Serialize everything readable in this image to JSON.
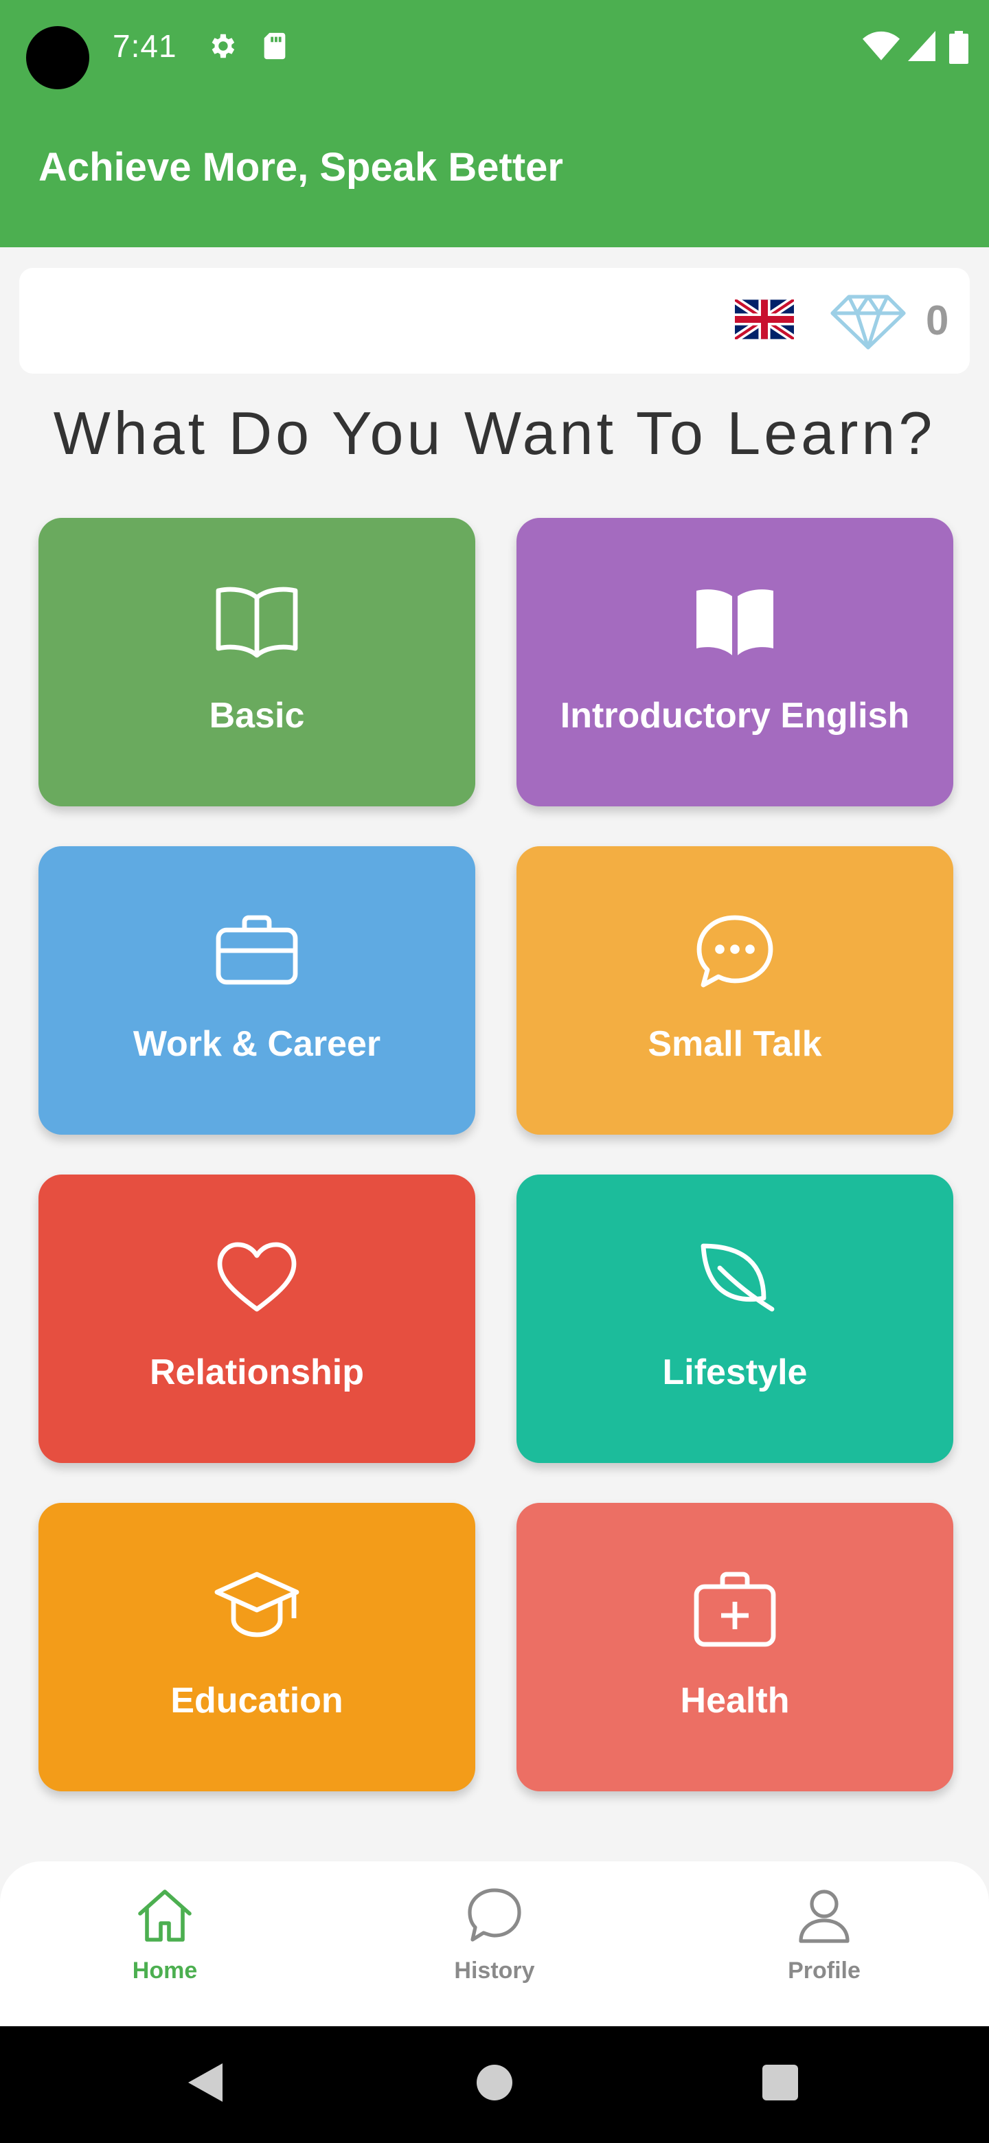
{
  "status_bar": {
    "time": "7:41",
    "icons": [
      "gear-icon",
      "sd-card-icon",
      "wifi-icon",
      "signal-icon",
      "battery-icon"
    ]
  },
  "app_bar": {
    "title": "Achieve More, Speak Better"
  },
  "top_card": {
    "flag_icon": "uk-flag-icon",
    "gem_icon": "diamond-icon",
    "gem_count": "0"
  },
  "headline": "What Do You Want To Learn?",
  "categories": [
    {
      "label": "Basic",
      "icon": "open-book-outline-icon",
      "color": "#6aaa5e"
    },
    {
      "label": "Introductory English",
      "icon": "open-book-filled-icon",
      "color": "#a46bbf"
    },
    {
      "label": "Work & Career",
      "icon": "briefcase-icon",
      "color": "#5faae2"
    },
    {
      "label": "Small Talk",
      "icon": "chat-bubble-icon",
      "color": "#f3ae42"
    },
    {
      "label": "Relationship",
      "icon": "heart-icon",
      "color": "#e64f40"
    },
    {
      "label": "Lifestyle",
      "icon": "leaf-icon",
      "color": "#1cbc9b"
    },
    {
      "label": "Education",
      "icon": "graduation-cap-icon",
      "color": "#f39c19"
    },
    {
      "label": "Health",
      "icon": "medical-kit-icon",
      "color": "#ec6f64"
    }
  ],
  "bottom_nav": {
    "items": [
      {
        "label": "Home",
        "icon": "home-icon",
        "active": true
      },
      {
        "label": "History",
        "icon": "chat-bubble-icon",
        "active": false
      },
      {
        "label": "Profile",
        "icon": "person-icon",
        "active": false
      }
    ],
    "active_color": "#4caf50",
    "inactive_color": "#8a8a8a"
  },
  "system_nav": [
    "back-icon",
    "home-circle-icon",
    "recents-icon"
  ]
}
